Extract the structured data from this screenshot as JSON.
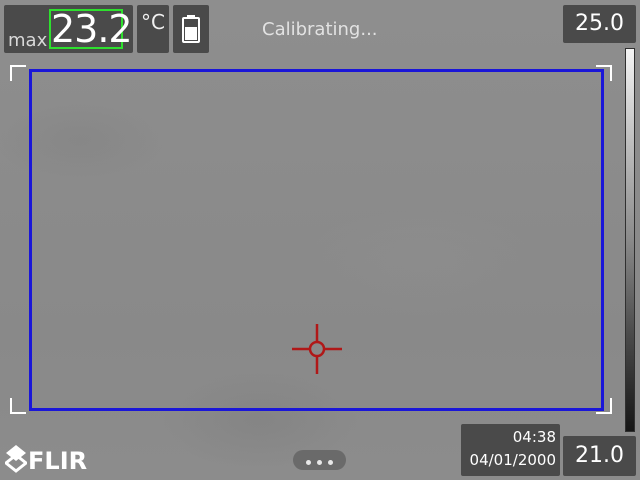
{
  "measurement": {
    "max_label": "max",
    "max_value": "23.2",
    "unit": "°C"
  },
  "status": {
    "text": "Calibrating..."
  },
  "scale": {
    "max": "25.0",
    "min": "21.0"
  },
  "datetime": {
    "time": "04:38",
    "date": "04/01/2000"
  },
  "brand": {
    "logo_text": "FLIR"
  },
  "icons": {
    "battery": "battery-icon",
    "spot_meter": "crosshair-icon",
    "menu": "more-dots-icon",
    "logo": "flir-logo-icon"
  },
  "colors": {
    "max_frame": "#2ee02e",
    "measurement_area": "#1a16d8",
    "spot_meter": "#b01818",
    "panel_bg": "#4a4a4a"
  }
}
